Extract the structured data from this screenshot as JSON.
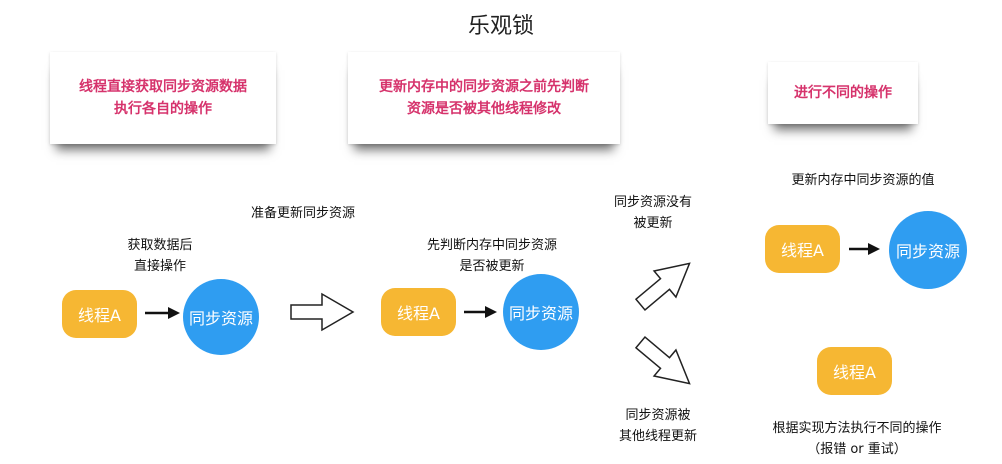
{
  "title": "乐观锁",
  "notes": [
    {
      "line1": "线程直接获取同步资源数据",
      "line2": "执行各自的操作"
    },
    {
      "line1": "更新内存中的同步资源之前先判断",
      "line2": "资源是否被其他线程修改"
    },
    {
      "line1": "进行不同的操作",
      "line2": ""
    }
  ],
  "step1": {
    "caption_line1": "获取数据后",
    "caption_line2": "直接操作",
    "thread": "线程A",
    "resource": "同步资源"
  },
  "prepare_label": "准备更新同步资源",
  "step2": {
    "caption_line1": "先判断内存中同步资源",
    "caption_line2": "是否被更新",
    "thread": "线程A",
    "resource": "同步资源"
  },
  "branch_up": {
    "line1": "同步资源没有",
    "line2": "被更新"
  },
  "branch_down": {
    "line1": "同步资源被",
    "line2": "其他线程更新"
  },
  "result_success": {
    "caption": "更新内存中同步资源的值",
    "thread": "线程A",
    "resource": "同步资源"
  },
  "result_fail": {
    "thread": "线程A",
    "line1": "根据实现方法执行不同的操作",
    "line2": "（报错 or 重试）"
  }
}
